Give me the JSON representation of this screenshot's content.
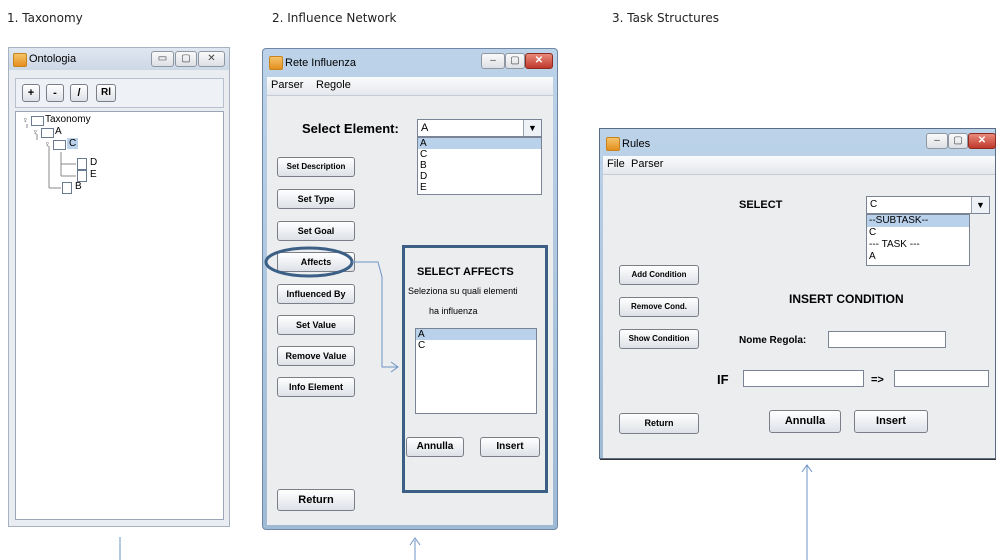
{
  "captions": [
    "1. Taxonomy",
    "2. Influence Network",
    "3. Task Structures"
  ],
  "ontologia": {
    "title": "Ontologia",
    "window_buttons": [
      "▭",
      "▢",
      "✕"
    ],
    "toolbar": [
      "+",
      "-",
      "/",
      "Rl"
    ],
    "tree": [
      "Taxonomy",
      "A",
      "C",
      "D",
      "E",
      "B"
    ]
  },
  "rete": {
    "title": "Rete Influenza",
    "window_buttons": [
      "–",
      "▢",
      "✕"
    ],
    "menu": [
      "Parser",
      "Regole"
    ],
    "select_label": "Select Element:",
    "select_value": "A",
    "dropdown_items": [
      "A",
      "C",
      "B",
      "D",
      "E"
    ],
    "buttons": [
      "Set Description",
      "Set Type",
      "Set Goal",
      "Affects",
      "Influenced By",
      "Set Value",
      "Remove Value",
      "Info Element"
    ],
    "affects_title": "SELECT AFFECTS",
    "affects_line1": "Seleziona su quali elementi",
    "affects_line2": "ha influenza",
    "affects_list": [
      "A",
      "C"
    ],
    "annulla": "Annulla",
    "insert": "Insert",
    "return": "Return"
  },
  "rules": {
    "title": "Rules",
    "window_buttons": [
      "–",
      "▢",
      "✕"
    ],
    "menu": [
      "File",
      "Parser"
    ],
    "select_label": "SELECT",
    "select_value": "C",
    "dropdown_items": [
      "--SUBTASK--",
      "C",
      "--- TASK ---",
      "A"
    ],
    "left_buttons": [
      "Add Condition",
      "Remove Cond.",
      "Show Condition"
    ],
    "insert_condition": "INSERT CONDITION",
    "nome_regola_label": "Nome Regola:",
    "if_label": "IF",
    "arrow_label": "=>",
    "return": "Return",
    "annulla": "Annulla",
    "insert": "Insert"
  },
  "colors": {
    "highlight": "#3c5f86",
    "selection": "#b9d1ea",
    "arrow": "#6c93c4"
  }
}
